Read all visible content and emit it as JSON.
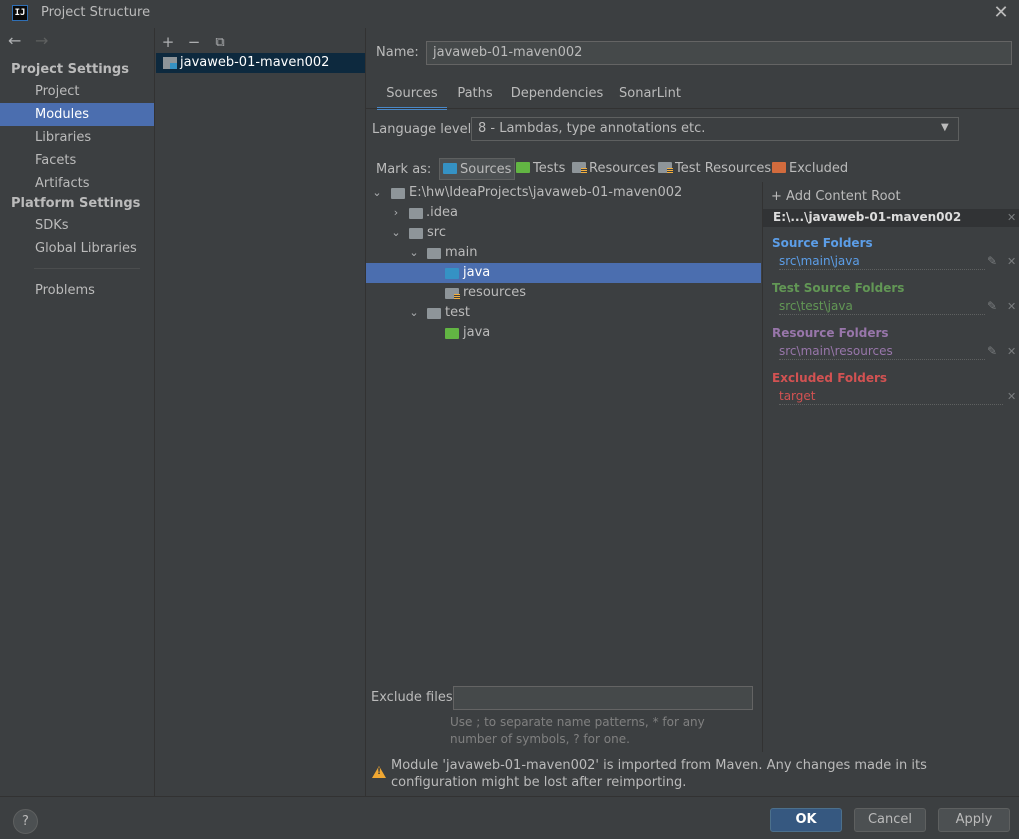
{
  "window": {
    "title": "Project Structure",
    "logo_text": "IJ",
    "close_glyph": "✕"
  },
  "nav": {
    "back_glyph": "←",
    "forward_glyph": "→",
    "project_settings_heading": "Project Settings",
    "platform_settings_heading": "Platform Settings",
    "project_items": [
      "Project",
      "Modules",
      "Libraries",
      "Facets",
      "Artifacts"
    ],
    "platform_items": [
      "SDKs",
      "Global Libraries"
    ],
    "problems_label": "Problems",
    "selected": "Modules"
  },
  "module_list": {
    "add_glyph": "+",
    "remove_glyph": "−",
    "copy_glyph": "⧉",
    "modules": [
      "javaweb-01-maven002"
    ]
  },
  "module": {
    "name_label": "Name:",
    "name_value": "javaweb-01-maven002",
    "tabs": [
      "Sources",
      "Paths",
      "Dependencies",
      "SonarLint"
    ],
    "active_tab": "Sources",
    "language_level_label": "Language level:",
    "language_level_value": "8 - Lambdas, type annotations etc."
  },
  "mark_as": {
    "label": "Mark as:",
    "buttons": [
      "Sources",
      "Tests",
      "Resources",
      "Test Resources",
      "Excluded"
    ],
    "pressed": "Sources"
  },
  "tree": {
    "root": "E:\\hw\\IdeaProjects\\javaweb-01-maven002",
    "idea": ".idea",
    "src": "src",
    "main": "main",
    "main_java": "java",
    "resources": "resources",
    "test": "test",
    "test_java": "java"
  },
  "content_root": {
    "add_label": "+ Add Content Root",
    "path": "E:\\...\\javaweb-01-maven002",
    "source_title": "Source Folders",
    "source_path": "src\\main\\java",
    "test_title": "Test Source Folders",
    "test_path": "src\\test\\java",
    "resource_title": "Resource Folders",
    "resource_path": "src\\main\\resources",
    "excluded_title": "Excluded Folders",
    "excluded_path": "target",
    "colors": {
      "source": "#5c9ee8",
      "test": "#629755",
      "resource": "#9876aa",
      "excluded": "#d25252"
    }
  },
  "exclude": {
    "label": "Exclude files:",
    "value": "",
    "hint": "Use ; to separate name patterns, * for any number of symbols, ? for one."
  },
  "warning": {
    "text": "Module 'javaweb-01-maven002' is imported from Maven. Any changes made in its configuration might be lost after reimporting."
  },
  "footer": {
    "help": "?",
    "ok": "OK",
    "cancel": "Cancel",
    "apply": "Apply"
  }
}
